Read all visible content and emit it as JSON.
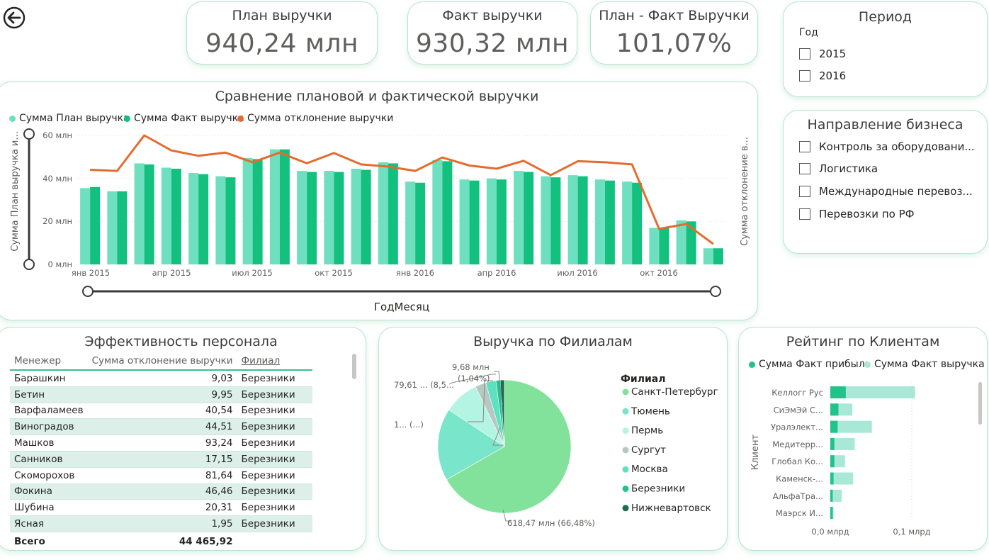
{
  "kpis": {
    "plan": {
      "label": "План выручки",
      "value": "940,24 млн"
    },
    "fact": {
      "label": "Факт выручки",
      "value": "930,32 млн"
    },
    "ratio": {
      "label": "План - Факт Выручки",
      "value": "101,07%"
    }
  },
  "period_slicer": {
    "title": "Период",
    "subtitle": "Год",
    "options": [
      {
        "label": "2015",
        "checked": false
      },
      {
        "label": "2016",
        "checked": false
      }
    ]
  },
  "business_slicer": {
    "title": "Направление бизнеса",
    "options": [
      {
        "label": "Контроль за оборудовани...",
        "checked": false
      },
      {
        "label": "Логистика",
        "checked": false
      },
      {
        "label": "Международные перевоз...",
        "checked": false
      },
      {
        "label": "Перевозки по РФ",
        "checked": false
      }
    ]
  },
  "combo": {
    "title": "Сравнение плановой и фактической выручки",
    "legend": [
      "Сумма План выручка",
      "Сумма Факт выручка",
      "Сумма отклонение выручки"
    ],
    "y_label": "Сумма План выручка и...",
    "y2_label": "Сумма отклонение в...",
    "x_label": "ГодМесяц",
    "y_ticks": [
      "60 млн",
      "40 млн",
      "20 млн",
      "0 млн"
    ],
    "x_ticks": [
      "янв 2015",
      "апр 2015",
      "июл 2015",
      "окт 2015",
      "янв 2016",
      "апр 2016",
      "июл 2016",
      "окт 2016"
    ]
  },
  "chart_data": {
    "type": "bar",
    "title": "Сравнение плановой и фактической выручки",
    "xlabel": "ГодМесяц",
    "ylabel": "Сумма План выручка и...",
    "ylim": [
      0,
      60
    ],
    "categories": [
      "янв 2015",
      "фев 2015",
      "мар 2015",
      "апр 2015",
      "май 2015",
      "июн 2015",
      "июл 2015",
      "авг 2015",
      "сен 2015",
      "окт 2015",
      "ноя 2015",
      "дек 2015",
      "янв 2016",
      "фев 2016",
      "мар 2016",
      "апр 2016",
      "май 2016",
      "июн 2016",
      "июл 2016",
      "авг 2016",
      "сен 2016",
      "окт 2016",
      "ноя 2016",
      "дек 2016"
    ],
    "series": [
      {
        "name": "Сумма План выручка",
        "type": "bar",
        "color": "#6ee0bf",
        "values": [
          35.5,
          34,
          47,
          45,
          42.5,
          41,
          49.5,
          53.5,
          43.5,
          43.5,
          44.5,
          47.5,
          38.5,
          48.5,
          39.5,
          40,
          43.5,
          41,
          41.5,
          39.5,
          38.5,
          17,
          20.5,
          7.5
        ]
      },
      {
        "name": "Сумма Факт выручка",
        "type": "bar",
        "color": "#13c07e",
        "values": [
          36,
          34,
          46.5,
          44.5,
          42,
          40.5,
          49,
          53.5,
          43,
          43,
          44,
          47,
          38,
          48,
          39,
          39.5,
          43,
          40.5,
          41,
          39,
          38,
          17,
          20,
          7.5
        ]
      },
      {
        "name": "Сумма отклонение выручки",
        "type": "line",
        "color": "#e36c2e",
        "values": [
          44,
          43.5,
          60,
          53,
          50.5,
          52,
          47.5,
          52,
          47,
          51.8,
          46.5,
          45.5,
          43.5,
          49.7,
          46,
          44.5,
          48.2,
          41.5,
          48,
          47.5,
          46.5,
          16.5,
          18.8,
          9.5
        ]
      }
    ]
  },
  "staff": {
    "title": "Эффективность персонала",
    "columns": [
      "Менежер",
      "Сумма отклонение выручки",
      "Филиал"
    ],
    "rows": [
      [
        "Барашкин",
        "9,03",
        "Березники"
      ],
      [
        "Бетин",
        "9,95",
        "Березники"
      ],
      [
        "Варфаламеев",
        "40,54",
        "Березники"
      ],
      [
        "Виноградов",
        "44,51",
        "Березники"
      ],
      [
        "Машков",
        "93,24",
        "Березники"
      ],
      [
        "Санников",
        "17,15",
        "Березники"
      ],
      [
        "Скоморохов",
        "81,64",
        "Березники"
      ],
      [
        "Фокина",
        "46,46",
        "Березники"
      ],
      [
        "Шубина",
        "20,31",
        "Березники"
      ],
      [
        "Ясная",
        "1,95",
        "Березники"
      ]
    ],
    "total_label": "Всего",
    "total_value": "44 465,92"
  },
  "pie": {
    "title": "Выручка по Филиалам",
    "legend_title": "Филиал",
    "slices": [
      {
        "name": "Санкт-Петербург",
        "percent": 66.48,
        "color": "#82e29b"
      },
      {
        "name": "Тюмень",
        "percent": 17.5,
        "color": "#79e6cb"
      },
      {
        "name": "Пермь",
        "percent": 8.5,
        "color": "#b4f4e3"
      },
      {
        "name": "Сургут",
        "percent": 2.6,
        "color": "#b6c8c1"
      },
      {
        "name": "Москва",
        "percent": 2.5,
        "color": "#5ee0c1"
      },
      {
        "name": "Березники",
        "percent": 1.04,
        "color": "#20c38a"
      },
      {
        "name": "Нижневартовск",
        "percent": 1.0,
        "color": "#1f6b53"
      }
    ],
    "labels": {
      "top_value": "9,68 млн",
      "top_pct": "(1,04%)",
      "left1": "79,61 ... (8,5...",
      "left2": "1... (...)",
      "bottom": "618,47 млн (66,48%)"
    }
  },
  "clients": {
    "title": "Рейтинг по Клиентам",
    "legend": [
      "Сумма Факт прибыль",
      "Сумма Факт выручка"
    ],
    "axis_label": "Клиент",
    "x_ticks": [
      "0,0 млрд",
      "0,1 млрд"
    ],
    "rows": [
      {
        "name": "Келлогг Рус",
        "profit": 0.019,
        "revenue": 0.104
      },
      {
        "name": "СиЭмЭй С...",
        "profit": 0.01,
        "revenue": 0.027
      },
      {
        "name": "Уралэлект...",
        "profit": 0.009,
        "revenue": 0.051
      },
      {
        "name": "Медитерр...",
        "profit": 0.005,
        "revenue": 0.03
      },
      {
        "name": "Глобал Ко...",
        "profit": 0.005,
        "revenue": 0.018
      },
      {
        "name": "Каменск-...",
        "profit": 0.004,
        "revenue": 0.028
      },
      {
        "name": "АльфаТра...",
        "profit": 0.003,
        "revenue": 0.014
      },
      {
        "name": "Маэрск И...",
        "profit": 0.003,
        "revenue": 0.004
      }
    ]
  },
  "colors": {
    "plan": "#6ee0bf",
    "fact": "#13c07e",
    "deviation": "#e36c2e",
    "accent": "#2bbf8e"
  }
}
